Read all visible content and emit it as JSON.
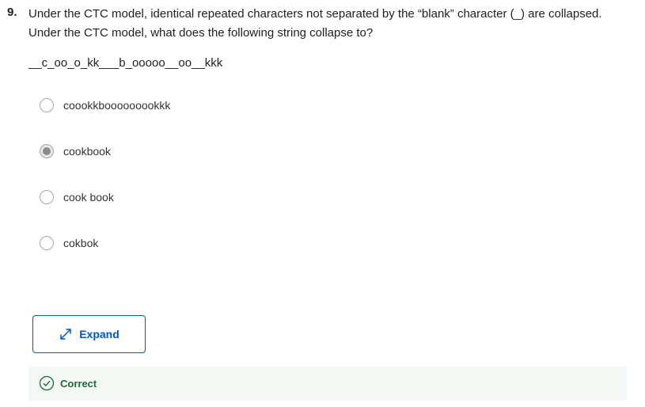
{
  "question": {
    "number": "9.",
    "line1": "Under the CTC model, identical repeated characters not separated by the “blank” character (_) are collapsed.",
    "line2": "Under the CTC model, what does the following string collapse to?",
    "string": "__c_oo_o_kk___b_ooooo__oo__kkk"
  },
  "options": [
    {
      "label": "coookkbooooooookkk",
      "selected": false
    },
    {
      "label": "cookbook",
      "selected": true
    },
    {
      "label": "cook book",
      "selected": false
    },
    {
      "label": "cokbok",
      "selected": false
    }
  ],
  "expand_button": {
    "label": "Expand",
    "icon": "expand-arrows-icon"
  },
  "feedback": {
    "label": "Correct",
    "icon": "check-circle-icon",
    "color": "#1f6b3a"
  },
  "colors": {
    "accent": "#0056d2",
    "success": "#1f6b3a",
    "feedback_bg": "#f3f8f4"
  }
}
